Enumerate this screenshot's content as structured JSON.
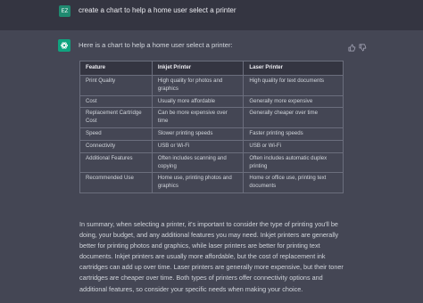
{
  "user": {
    "avatar_initials": "EZ",
    "message": "create a chart to help a home user select a printer"
  },
  "assistant": {
    "intro": "Here is a chart to help a home user select a printer:",
    "table": {
      "headers": [
        "Feature",
        "Inkjet Printer",
        "Laser Printer"
      ],
      "rows": [
        [
          "Print Quality",
          "High quality for photos and graphics",
          "High quality for text documents"
        ],
        [
          "Cost",
          "Usually more affordable",
          "Generally more expensive"
        ],
        [
          "Replacement Cartridge Cost",
          "Can be more expensive over time",
          "Generally cheaper over time"
        ],
        [
          "Speed",
          "Slower printing speeds",
          "Faster printing speeds"
        ],
        [
          "Connectivity",
          "USB or Wi-Fi",
          "USB or Wi-Fi"
        ],
        [
          "Additional Features",
          "Often includes scanning and copying",
          "Often includes automatic duplex printing"
        ],
        [
          "Recommended Use",
          "Home use, printing photos and graphics",
          "Home or office use, printing text documents"
        ]
      ]
    },
    "summary": "In summary, when selecting a printer, it's important to consider the type of printing you'll be doing, your budget, and any additional features you may need. Inkjet printers are generally better for printing photos and graphics, while laser printers are better for printing text documents. Inkjet printers are usually more affordable, but the cost of replacement ink cartridges can add up over time. Laser printers are generally more expensive, but their toner cartridges are cheaper over time. Both types of printers offer connectivity options and additional features, so consider your specific needs when making your choice."
  },
  "icons": {
    "bot_avatar": "openai-logo-icon",
    "feedback_up": "thumbs-up-icon",
    "feedback_down": "thumbs-down-icon"
  },
  "colors": {
    "page_bg": "#444654",
    "user_row_bg": "#343541",
    "bot_avatar_bg": "#10a37f",
    "user_avatar_bg": "#1f8a70"
  }
}
